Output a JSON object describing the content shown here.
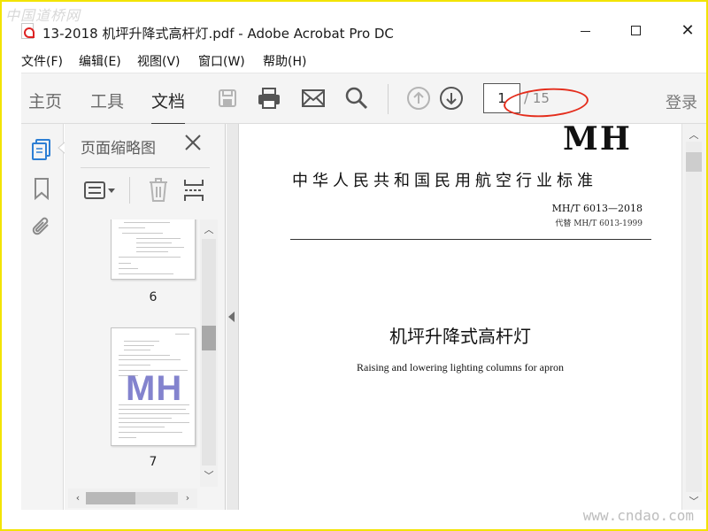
{
  "watermarks": {
    "top_left": "中国道桥网",
    "bottom_right": "www.cndao.com"
  },
  "window": {
    "title": "13-2018 机坪升降式高杆灯.pdf - Adobe Acrobat Pro DC",
    "app_icon": "pdf-file-icon"
  },
  "menu": {
    "items": [
      {
        "label": "文件(F)"
      },
      {
        "label": "编辑(E)"
      },
      {
        "label": "视图(V)"
      },
      {
        "label": "窗口(W)"
      },
      {
        "label": "帮助(H)"
      }
    ]
  },
  "toolbar": {
    "tabs": [
      {
        "label": "主页"
      },
      {
        "label": "工具"
      },
      {
        "label": "文档"
      }
    ],
    "active_tab": "文档",
    "icons": [
      "save-icon",
      "print-icon",
      "email-icon",
      "search-icon",
      "previous-page-icon",
      "next-page-icon"
    ],
    "current_page": "1",
    "total_pages": "/ 15",
    "login_label": "登录",
    "highlight_color": "#e42d1c"
  },
  "left_rail": {
    "icons": [
      "page-thumbnails-icon",
      "bookmark-icon",
      "attachment-icon"
    ],
    "accent_color": "#2d7fd4"
  },
  "thumbnail_panel": {
    "title": "页面缩略图",
    "tools": [
      "thumbnail-options-icon",
      "delete-icon",
      "rotate-pages-icon"
    ],
    "thumbnails": [
      {
        "page_label": "6"
      },
      {
        "page_label": "7",
        "watermark": "MH"
      }
    ]
  },
  "document": {
    "header_code": "MH",
    "standard_name": "中华人民共和国民用航空行业标准",
    "standard_number": "MH/T 6013—2018",
    "replaces": "代替 MH/T 6013-1999",
    "title_cn": "机坪升降式高杆灯",
    "title_en": "Raising and lowering lighting columns for apron"
  }
}
